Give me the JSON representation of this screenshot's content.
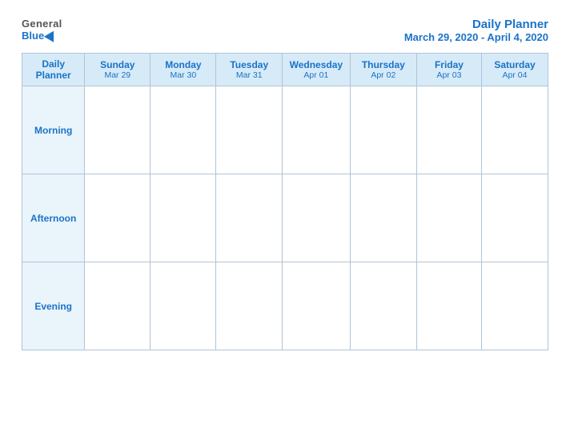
{
  "logo": {
    "general": "General",
    "blue": "Blue"
  },
  "header": {
    "title": "Daily Planner",
    "date_range": "March 29, 2020 - April 4, 2020"
  },
  "table": {
    "label_col": "Daily Planner",
    "days": [
      {
        "name": "Sunday",
        "date": "Mar 29"
      },
      {
        "name": "Monday",
        "date": "Mar 30"
      },
      {
        "name": "Tuesday",
        "date": "Mar 31"
      },
      {
        "name": "Wednesday",
        "date": "Apr 01"
      },
      {
        "name": "Thursday",
        "date": "Apr 02"
      },
      {
        "name": "Friday",
        "date": "Apr 03"
      },
      {
        "name": "Saturday",
        "date": "Apr 04"
      }
    ],
    "rows": [
      {
        "label": "Morning"
      },
      {
        "label": "Afternoon"
      },
      {
        "label": "Evening"
      }
    ]
  }
}
